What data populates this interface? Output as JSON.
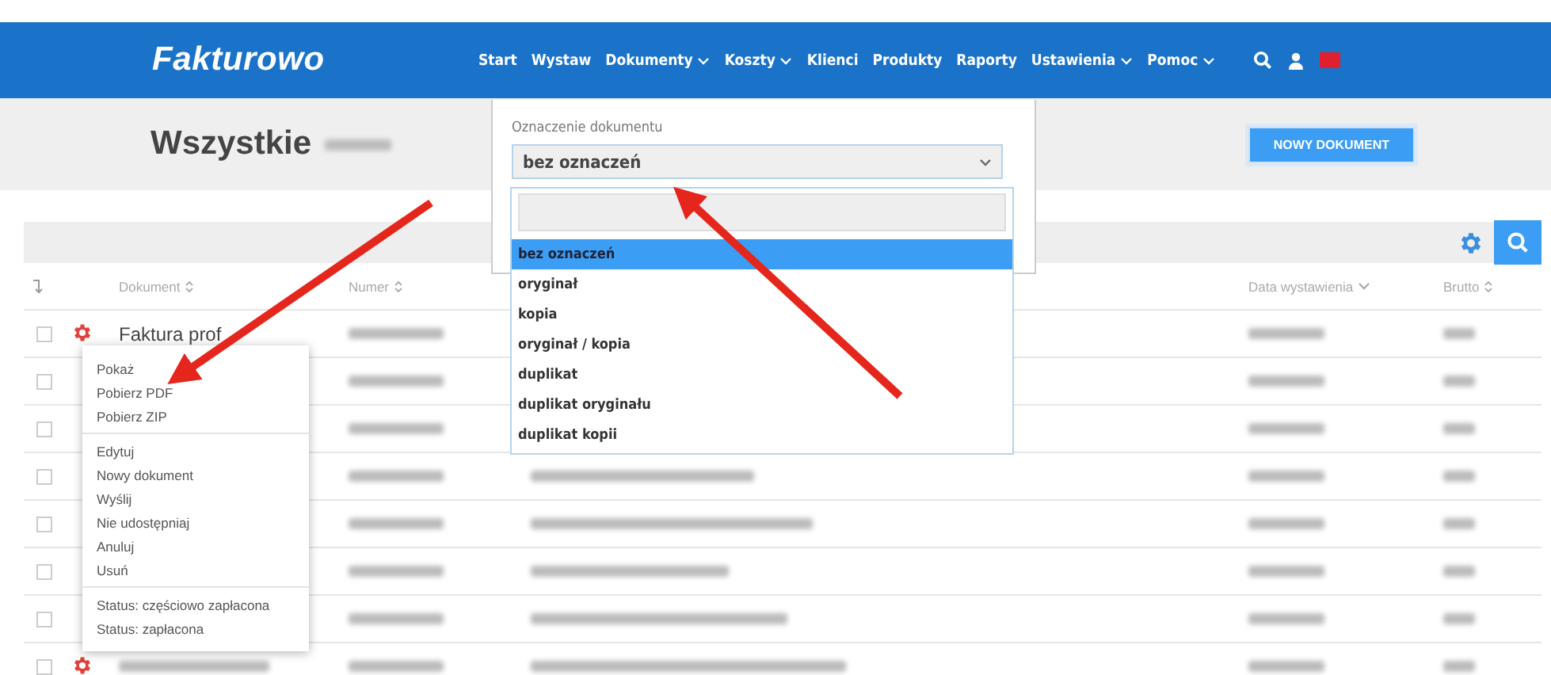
{
  "header": {
    "logo": "Fakturowo",
    "nav": [
      {
        "label": "Start",
        "dropdown": false
      },
      {
        "label": "Wystaw",
        "dropdown": false
      },
      {
        "label": "Dokumenty",
        "dropdown": true
      },
      {
        "label": "Koszty",
        "dropdown": true
      },
      {
        "label": "Klienci",
        "dropdown": false
      },
      {
        "label": "Produkty",
        "dropdown": false
      },
      {
        "label": "Raporty",
        "dropdown": false
      },
      {
        "label": "Ustawienia",
        "dropdown": true
      },
      {
        "label": "Pomoc",
        "dropdown": true
      }
    ]
  },
  "page": {
    "title": "Wszystkie",
    "new_button": "NOWY DOKUMENT"
  },
  "table": {
    "columns": [
      {
        "label": "Dokument",
        "sorted": false
      },
      {
        "label": "Numer",
        "sorted": false
      },
      {
        "label": "Data wystawienia",
        "sorted": true
      },
      {
        "label": "Brutto",
        "sorted": false
      }
    ],
    "rows": [
      {
        "checked": false,
        "gear": true,
        "document": "Faktura prof"
      },
      {
        "checked": false,
        "gear": false
      },
      {
        "checked": false,
        "gear": false
      },
      {
        "checked": false,
        "gear": false,
        "description_visible": true
      },
      {
        "checked": false,
        "gear": false,
        "description_visible": true
      },
      {
        "checked": false,
        "gear": false,
        "description_visible": true
      },
      {
        "checked": false,
        "gear": false,
        "description_visible": true
      },
      {
        "checked": false,
        "gear": true,
        "document_blurred": true,
        "description_visible": true
      }
    ]
  },
  "context_menu": {
    "groups": [
      [
        "Pokaż",
        "Pobierz PDF",
        "Pobierz ZIP"
      ],
      [
        "Edytuj",
        "Nowy dokument",
        "Wyślij",
        "Nie udostępniaj",
        "Anuluj",
        "Usuń"
      ],
      [
        "Status: częściowo zapłacona",
        "Status: zapłacona"
      ]
    ]
  },
  "filter": {
    "label": "Oznaczenie dokumentu",
    "value": "bez oznaczeń",
    "options": [
      {
        "label": "bez oznaczeń",
        "selected": true
      },
      {
        "label": "oryginał",
        "selected": false
      },
      {
        "label": "kopia",
        "selected": false
      },
      {
        "label": "oryginał / kopia",
        "selected": false
      },
      {
        "label": "duplikat",
        "selected": false
      },
      {
        "label": "duplikat oryginału",
        "selected": false
      },
      {
        "label": "duplikat kopii",
        "selected": false
      }
    ]
  }
}
